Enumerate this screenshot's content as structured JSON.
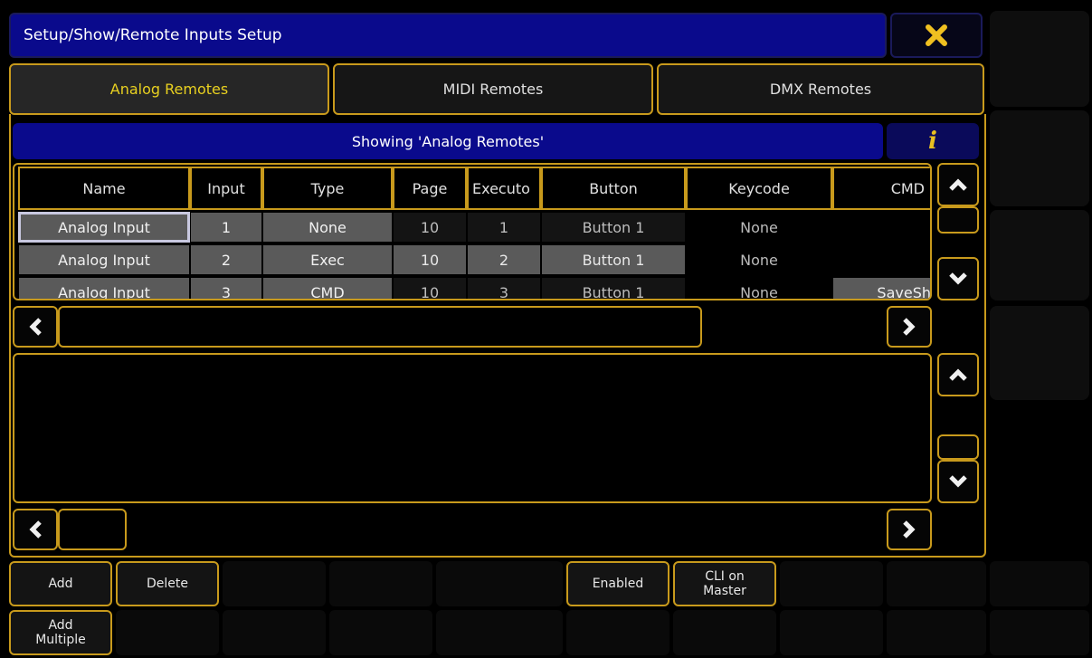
{
  "window": {
    "title": "Setup/Show/Remote Inputs Setup",
    "close_icon": "close-x-icon"
  },
  "tabs": [
    {
      "label": "Analog Remotes",
      "active": true
    },
    {
      "label": "MIDI Remotes",
      "active": false
    },
    {
      "label": "DMX Remotes",
      "active": false
    }
  ],
  "banner": {
    "text": "Showing 'Analog Remotes'",
    "info_label": "i"
  },
  "table": {
    "columns": [
      "Name",
      "Input",
      "Type",
      "Page",
      "Executo",
      "Button",
      "Keycode",
      "CMD"
    ],
    "rows": [
      {
        "name": "Analog Input",
        "input": "1",
        "type": "None",
        "page": "10",
        "exec": "1",
        "button": "Button 1",
        "keycode": "None",
        "cmd": ""
      },
      {
        "name": "Analog Input",
        "input": "2",
        "type": "Exec",
        "page": "10",
        "exec": "2",
        "button": "Button 1",
        "keycode": "None",
        "cmd": ""
      },
      {
        "name": "Analog Input",
        "input": "3",
        "type": "CMD",
        "page": "10",
        "exec": "3",
        "button": "Button 1",
        "keycode": "None",
        "cmd": "SaveSh"
      }
    ]
  },
  "bottom_buttons": {
    "add": "Add",
    "delete": "Delete",
    "enabled": "Enabled",
    "cli_on_master": "CLI on Master",
    "add_multiple": "Add Multiple"
  },
  "colors": {
    "accent": "#c89a1c",
    "title_bg": "#0a0a8c",
    "active_tab_text": "#e8d020"
  }
}
